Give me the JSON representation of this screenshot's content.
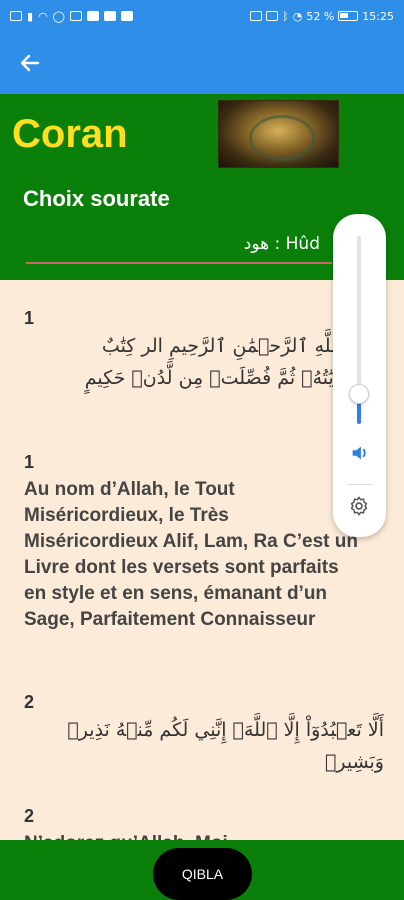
{
  "status_bar": {
    "left_icons": [
      "sim-icon",
      "signal-icon",
      "wifi-icon",
      "whatsapp-icon",
      "mail-icon",
      "app-icon",
      "app-icon",
      "app-icon"
    ],
    "right_icons": [
      "nfc-icon",
      "vibrate-icon",
      "bluetooth-icon",
      "mute-icon"
    ],
    "battery": "52 %",
    "time": "15:25"
  },
  "app_bar": {
    "back_icon": "arrow-left-icon"
  },
  "header": {
    "title": "Coran",
    "section_label": "Choix sourate",
    "selected_sura": "هود  :  Hûd"
  },
  "content": {
    "verses": [
      {
        "number": "1",
        "arabic": [
          "ٱللَّهِ ٱلرَّحۡمَٰنِ ٱلرَّحِيمِ الر كِتَٰبٌ",
          "ءَايَٰتُهُۥ ثُمَّ فُصِّلَتۡ مِن لَّدُنۡ حَكِيمٍ"
        ]
      },
      {
        "number": "1",
        "translation": " Au nom d’Allah, le Tout Miséricordieux, le Très Miséricordieux Alif, Lam, Ra C’est un Livre dont les versets sont parfaits en style et en sens, émanant d’un Sage, Parfaitement Connaisseur"
      },
      {
        "number": "2",
        "arabic": [
          "أَلَّا تَعۡبُدُوٓاْ إِلَّا ٱللَّهَۚ إِنَّنِي لَكُم مِّنۡهُ نَذِيرٞ",
          "وَبَشِيرٞ"
        ]
      },
      {
        "number": "2",
        "translation": " N’adorez qu’Allah. Moi..."
      }
    ]
  },
  "bottom_bar": {
    "qibla_label": "QIBLA"
  },
  "volume_panel": {
    "level": 0.16,
    "speaker_icon": "speaker-icon",
    "settings_icon": "gear-icon"
  },
  "colors": {
    "app_bar": "#2f8fe8",
    "header": "#0a7f0a",
    "title": "#ffdf1f",
    "background": "#fcebd8",
    "volume_fill": "#2f7fe8"
  }
}
